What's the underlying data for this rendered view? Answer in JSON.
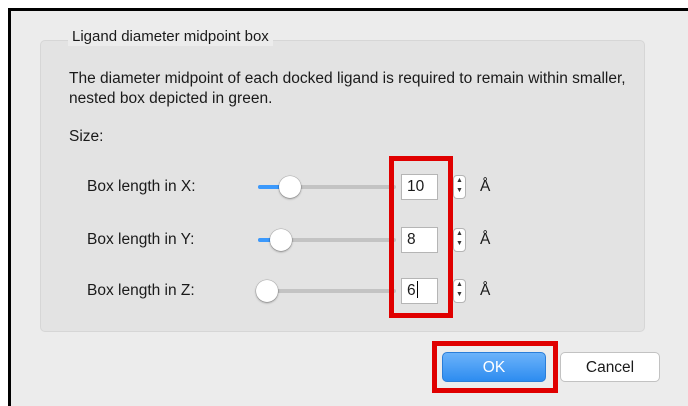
{
  "group": {
    "title": "Ligand diameter midpoint box",
    "description": "The diameter midpoint of each docked ligand is required to remain within smaller, nested box depicted in green.",
    "size_label": "Size:"
  },
  "rows": [
    {
      "label": "Box length in X:",
      "value": "10",
      "unit": "Å",
      "slider_fraction": 0.17
    },
    {
      "label": "Box length in Y:",
      "value": "8",
      "unit": "Å",
      "slider_fraction": 0.1
    },
    {
      "label": "Box length in Z:",
      "value": "6",
      "unit": "Å",
      "slider_fraction": 0.0
    }
  ],
  "buttons": {
    "ok": "OK",
    "cancel": "Cancel"
  },
  "colors": {
    "accent": "#3b99fc",
    "highlight": "#e00000"
  }
}
